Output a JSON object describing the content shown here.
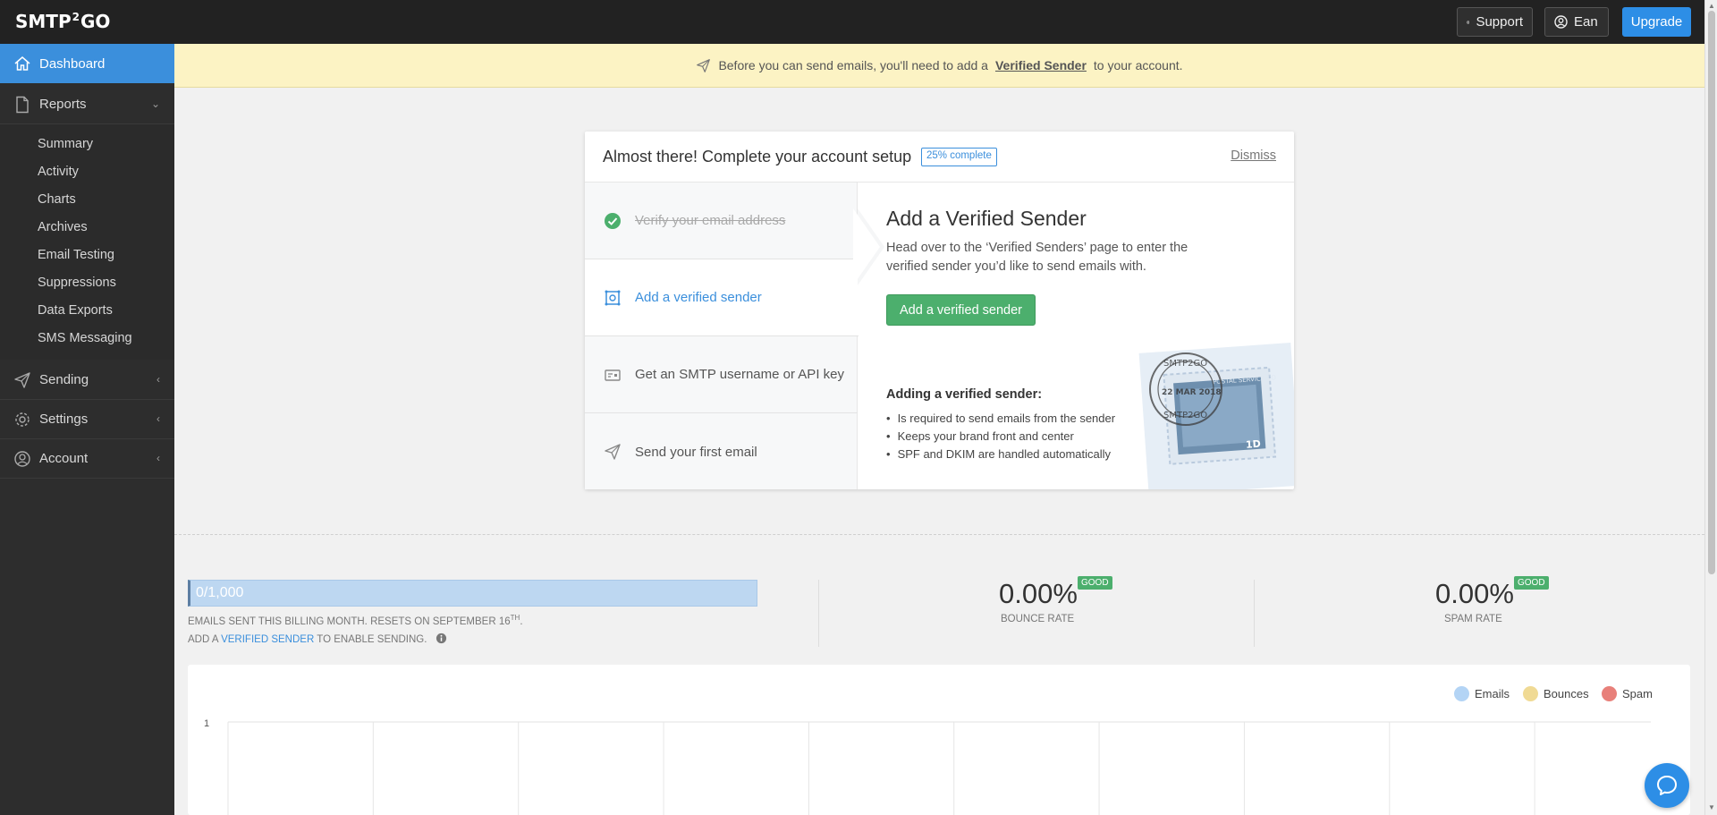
{
  "app": {
    "logo_left": "SMTP",
    "logo_mid": "2",
    "logo_right": "GO"
  },
  "topbar": {
    "support_label": "Support",
    "user_label": "Ean",
    "upgrade_label": "Upgrade"
  },
  "sidebar": {
    "dashboard": "Dashboard",
    "reports": "Reports",
    "report_items": [
      "Summary",
      "Activity",
      "Charts",
      "Archives",
      "Email Testing",
      "Suppressions",
      "Data Exports",
      "SMS Messaging"
    ],
    "sending": "Sending",
    "settings": "Settings",
    "account": "Account"
  },
  "banner": {
    "pre": "Before you can send emails, you'll need to add a",
    "link": "Verified Sender",
    "post": "to your account."
  },
  "setup": {
    "title": "Almost there! Complete your account setup",
    "progress_badge": "25% complete",
    "dismiss": "Dismiss",
    "steps": [
      {
        "label": "Verify your email address",
        "state": "done"
      },
      {
        "label": "Add a verified sender",
        "state": "active"
      },
      {
        "label": "Get an SMTP username or API key",
        "state": "todo"
      },
      {
        "label": "Send your first email",
        "state": "todo"
      }
    ],
    "detail_title": "Add a Verified Sender",
    "detail_desc": "Head over to the ‘Verified Senders’ page to enter the verified sender you’d like to send emails with.",
    "detail_button": "Add a verified sender",
    "adding_title": "Adding a verified sender:",
    "adding_points": [
      "Is required to send emails from the sender",
      "Keeps your brand front and center",
      "SPF and DKIM are handled automatically"
    ],
    "stamp": {
      "top_text": "SMTP2GO",
      "date_text": "22 MAR 2018",
      "bottom_text": "SMTP2GO",
      "postal_text": "POSTAL SERVICE CO",
      "value_text": "1D"
    }
  },
  "stats": {
    "quota": "0/1,000",
    "quota_line1": "Emails sent this billing month. Resets on September 16",
    "quota_line1_sup": "TH",
    "quota_line1_end": ".",
    "quota_line2_pre": "Add a",
    "quota_line2_link": "Verified Sender",
    "quota_line2_post": "to enable sending.",
    "bounce_rate": "0.00%",
    "bounce_label": "Bounce Rate",
    "bounce_badge": "GOOD",
    "spam_rate": "0.00%",
    "spam_label": "Spam Rate",
    "spam_badge": "GOOD"
  },
  "chart_data": {
    "type": "line",
    "title": "",
    "xlabel": "",
    "ylabel": "",
    "y_ticks": [
      "1"
    ],
    "ylim": [
      0,
      1
    ],
    "series": [
      {
        "name": "Emails",
        "color": "#b3d4f5",
        "values": []
      },
      {
        "name": "Bounces",
        "color": "#f0da94",
        "values": []
      },
      {
        "name": "Spam",
        "color": "#e8807a",
        "values": []
      }
    ],
    "grid": true,
    "legend": "top-right"
  },
  "colors": {
    "accent": "#3b8fdc",
    "success": "#4caf6d",
    "banner": "#fcf3c4",
    "sidebar": "#2d2d2d"
  },
  "icons": {
    "support": "globe-icon",
    "user": "user-circle-icon",
    "dashboard": "home-icon",
    "reports": "document-icon",
    "sending": "paper-plane-icon",
    "settings": "gear-icon",
    "account": "user-circle-icon",
    "chat": "chat-bubble-icon"
  }
}
